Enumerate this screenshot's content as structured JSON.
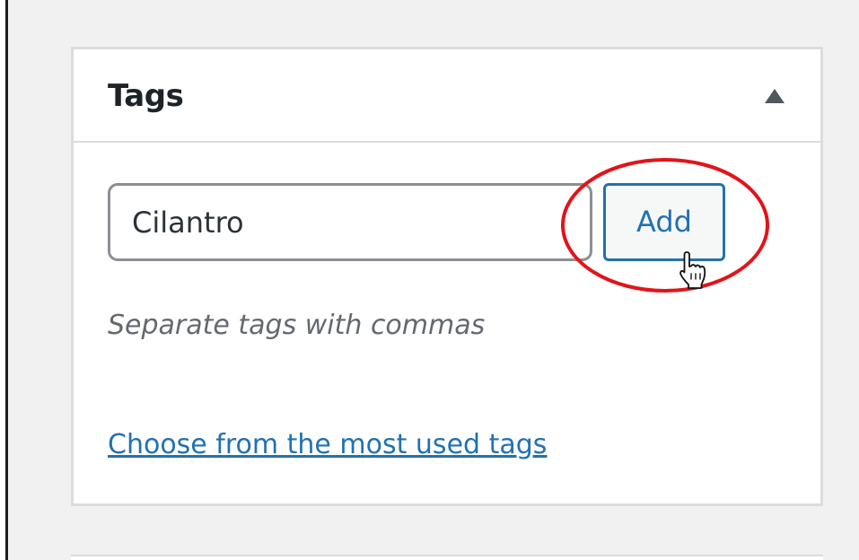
{
  "tags_box": {
    "title": "Tags",
    "toggle_icon": "triangle-up-icon",
    "input": {
      "value": "Cilantro",
      "placeholder": ""
    },
    "add_button_label": "Add",
    "hint": "Separate tags with commas",
    "most_used_link": "Choose from the most used tags"
  },
  "annotation": {
    "highlight_color": "#e0151b",
    "cursor_icon": "hand-pointer-icon"
  },
  "colors": {
    "accent": "#2271b1",
    "background": "#f1f1f1",
    "panel_border": "#dcdcde"
  }
}
